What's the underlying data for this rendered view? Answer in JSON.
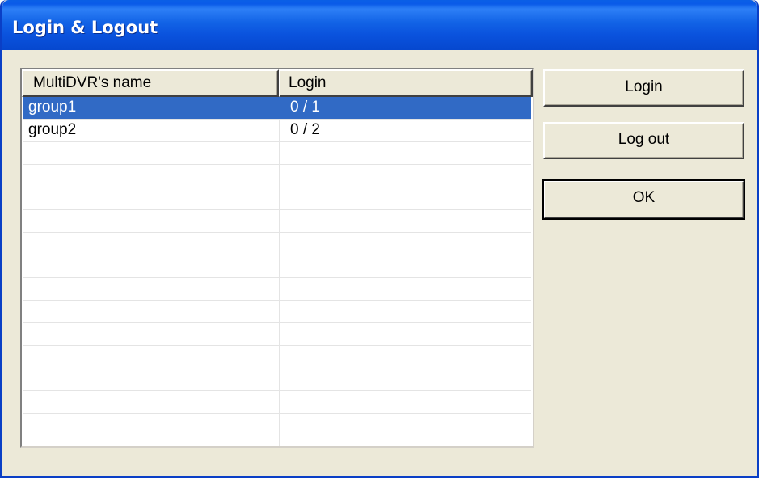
{
  "window": {
    "title": "Login & Logout"
  },
  "table": {
    "columns": [
      "MultiDVR's name",
      "Login"
    ],
    "rows": [
      {
        "name": "group1",
        "login": "0 / 1",
        "selected": true
      },
      {
        "name": "group2",
        "login": "0 / 2",
        "selected": false
      }
    ],
    "empty_row_count": 14
  },
  "buttons": {
    "login": "Login",
    "logout": "Log out",
    "ok": "OK"
  },
  "colors": {
    "titlebar": "#0a52dd",
    "selection": "#316ac5",
    "dialog_bg": "#ece9d8"
  }
}
